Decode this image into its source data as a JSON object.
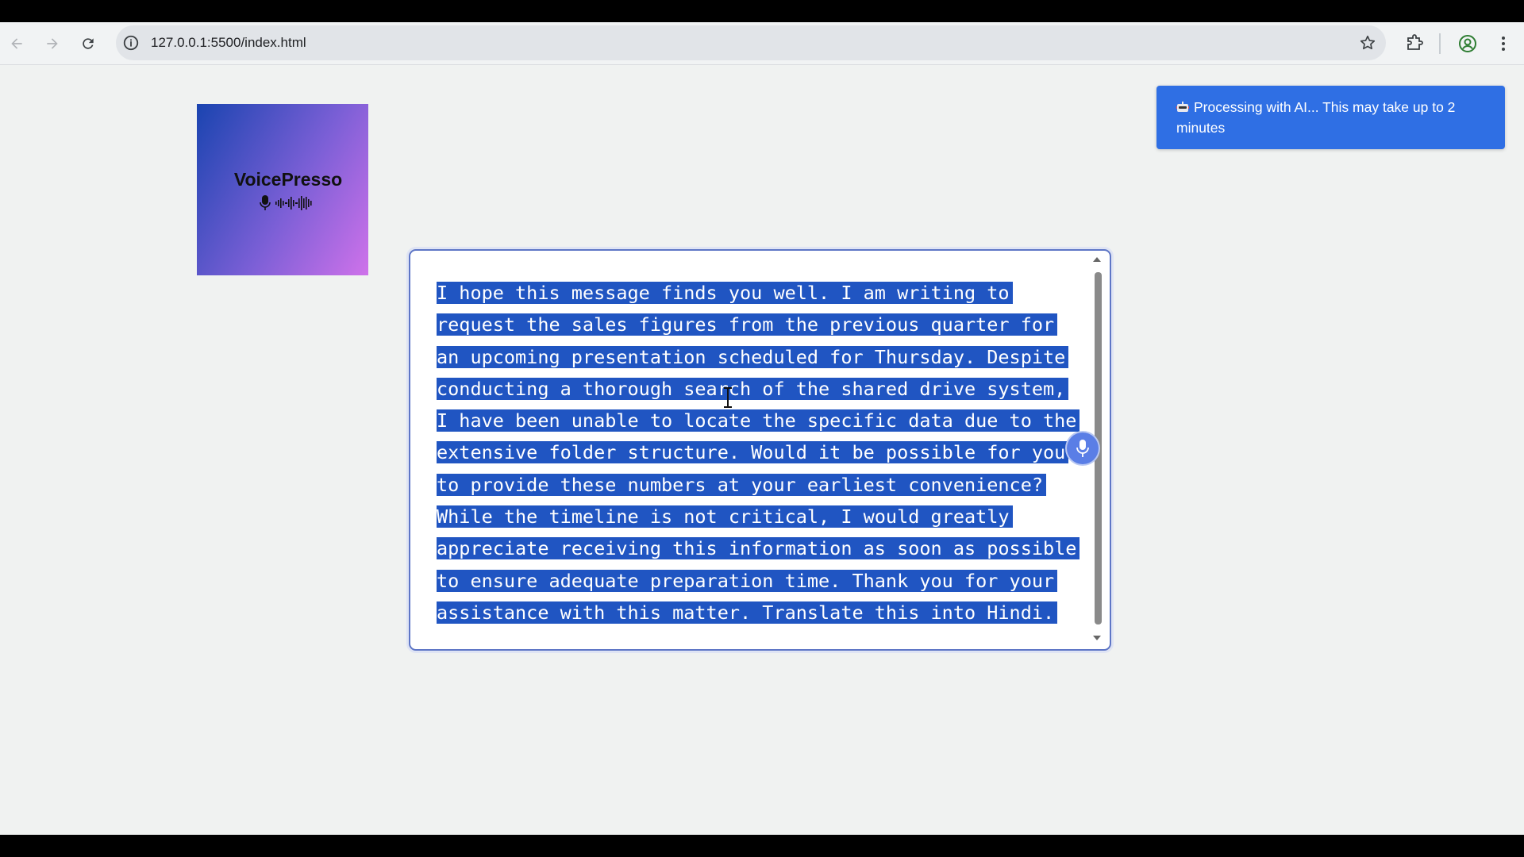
{
  "browser": {
    "url": "127.0.0.1:5500/index.html",
    "icons": [
      "back-icon",
      "forward-icon",
      "reload-icon",
      "info-icon",
      "star-icon",
      "extensions-icon",
      "profile-icon",
      "menu-icon"
    ]
  },
  "app": {
    "logo_text": "VoicePresso"
  },
  "toast": {
    "message": "Processing with AI... This may take up to 2 minutes",
    "color": "#2f6fe4"
  },
  "editor": {
    "lines": [
      "I hope this message finds you well. I am writing to",
      "request the sales figures from the previous quarter for",
      "an upcoming presentation scheduled for Thursday. Despite",
      "conducting a thorough search of the shared drive system,",
      "I have been unable to locate the specific data due to the",
      "extensive folder structure. Would it be possible for you",
      "to provide these numbers at your earliest convenience?",
      "While the timeline is not critical, I would greatly",
      "appreciate receiving this information as soon as possible",
      "to ensure adequate preparation time. Thank you for your",
      "assistance with this matter. Translate this into Hindi."
    ],
    "selection_color": "#2055c2"
  }
}
